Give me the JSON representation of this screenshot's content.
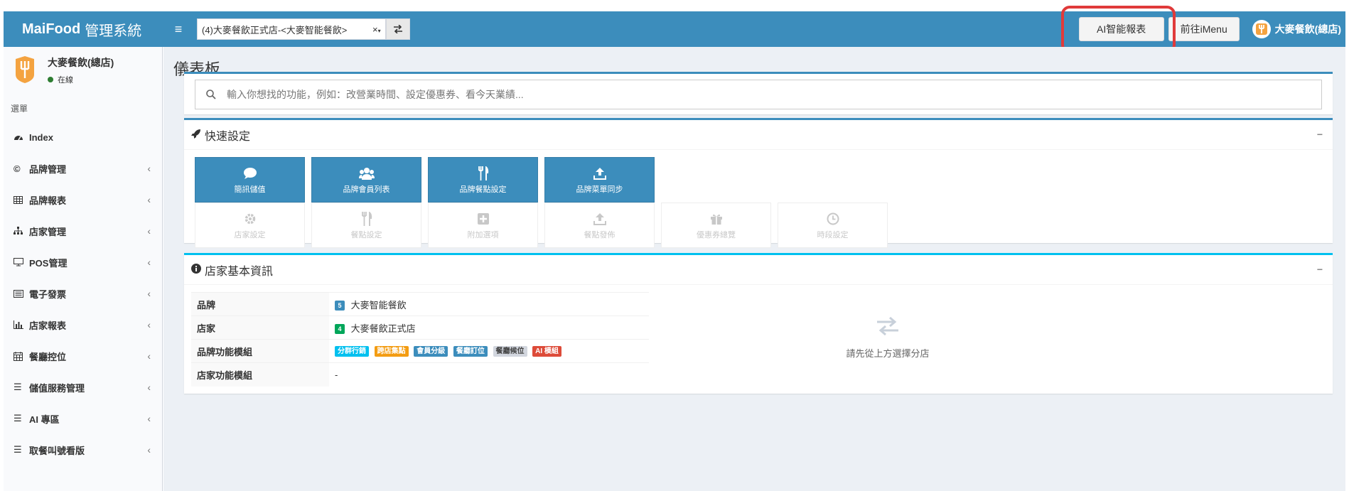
{
  "app": {
    "brand_bold": "MaiFood",
    "brand_rest": "管理系統"
  },
  "topbar": {
    "store_select_value": "(4)大麥餐飲正式店-<大麥智能餐飲>",
    "clear_glyph": "×",
    "ai_report_label": "AI智能報表",
    "imenu_label": "前往iMenu",
    "user_name": "大麥餐飲(總店)"
  },
  "sidebar": {
    "user_name": "大麥餐飲(總店)",
    "status": "在線",
    "menu_header": "選單",
    "items": [
      {
        "label": "Index",
        "icon": "dashboard-icon",
        "chevron": ""
      },
      {
        "label": "品牌管理",
        "icon": "copyright-icon",
        "chevron": "‹"
      },
      {
        "label": "品牌報表",
        "icon": "table-icon",
        "chevron": "‹"
      },
      {
        "label": "店家管理",
        "icon": "sitemap-icon",
        "chevron": "‹"
      },
      {
        "label": "POS管理",
        "icon": "desktop-icon",
        "chevron": "‹"
      },
      {
        "label": "電子發票",
        "icon": "invoice-icon",
        "chevron": "‹"
      },
      {
        "label": "店家報表",
        "icon": "bar-chart-icon",
        "chevron": "‹"
      },
      {
        "label": "餐廳控位",
        "icon": "calendar-icon",
        "chevron": "‹"
      },
      {
        "label": "儲值服務管理",
        "icon": "bars-icon",
        "chevron": "‹"
      },
      {
        "label": "AI 專區",
        "icon": "bars-icon",
        "chevron": "‹"
      },
      {
        "label": "取餐叫號看版",
        "icon": "bars-icon",
        "chevron": "‹"
      }
    ]
  },
  "page": {
    "title": "儀表板"
  },
  "search": {
    "placeholder": "輸入你想找的功能，例如：改營業時間、設定優惠券、看今天業績..."
  },
  "quick": {
    "title": "快速設定",
    "collapse": "−",
    "active_tiles": [
      {
        "label": "簡訊儲值",
        "icon": "comment-icon"
      },
      {
        "label": "品牌會員列表",
        "icon": "users-icon"
      },
      {
        "label": "品牌餐點設定",
        "icon": "cutlery-icon"
      },
      {
        "label": "品牌菜單同步",
        "icon": "upload-icon"
      }
    ],
    "disabled_tiles": [
      {
        "label": "店家設定",
        "icon": "gear-icon"
      },
      {
        "label": "餐點設定",
        "icon": "cutlery-icon"
      },
      {
        "label": "附加選項",
        "icon": "plus-square-icon"
      },
      {
        "label": "餐點發佈",
        "icon": "upload-icon"
      },
      {
        "label": "優惠券總覽",
        "icon": "gift-icon"
      },
      {
        "label": "時段設定",
        "icon": "clock-icon"
      }
    ]
  },
  "store_info": {
    "title": "店家基本資訊",
    "collapse": "−",
    "rows": {
      "brand_key": "品牌",
      "brand_badge": "5",
      "brand_value": "大麥智能餐飲",
      "store_key": "店家",
      "store_badge": "4",
      "store_value": "大麥餐飲正式店",
      "brand_modules_key": "品牌功能模組",
      "store_modules_key": "店家功能模組",
      "store_modules_value": "-"
    },
    "brand_modules": [
      {
        "label": "分群行銷",
        "color": "#00c0ef"
      },
      {
        "label": "跨店集點",
        "color": "#f39c12"
      },
      {
        "label": "會員分級",
        "color": "#3c8dbc"
      },
      {
        "label": "餐廳訂位",
        "color": "#3c8dbc"
      },
      {
        "label": "餐廳候位",
        "color": "#d2d6de"
      },
      {
        "label": "AI 模組",
        "color": "#dd4b39"
      }
    ],
    "placeholder_text": "請先從上方選擇分店"
  },
  "colors": {
    "primary": "#3c8dbc",
    "teal": "#00c0ef",
    "highlight": "#e03a3a",
    "online": "#2e7d32",
    "green_badge": "#00a65a"
  }
}
